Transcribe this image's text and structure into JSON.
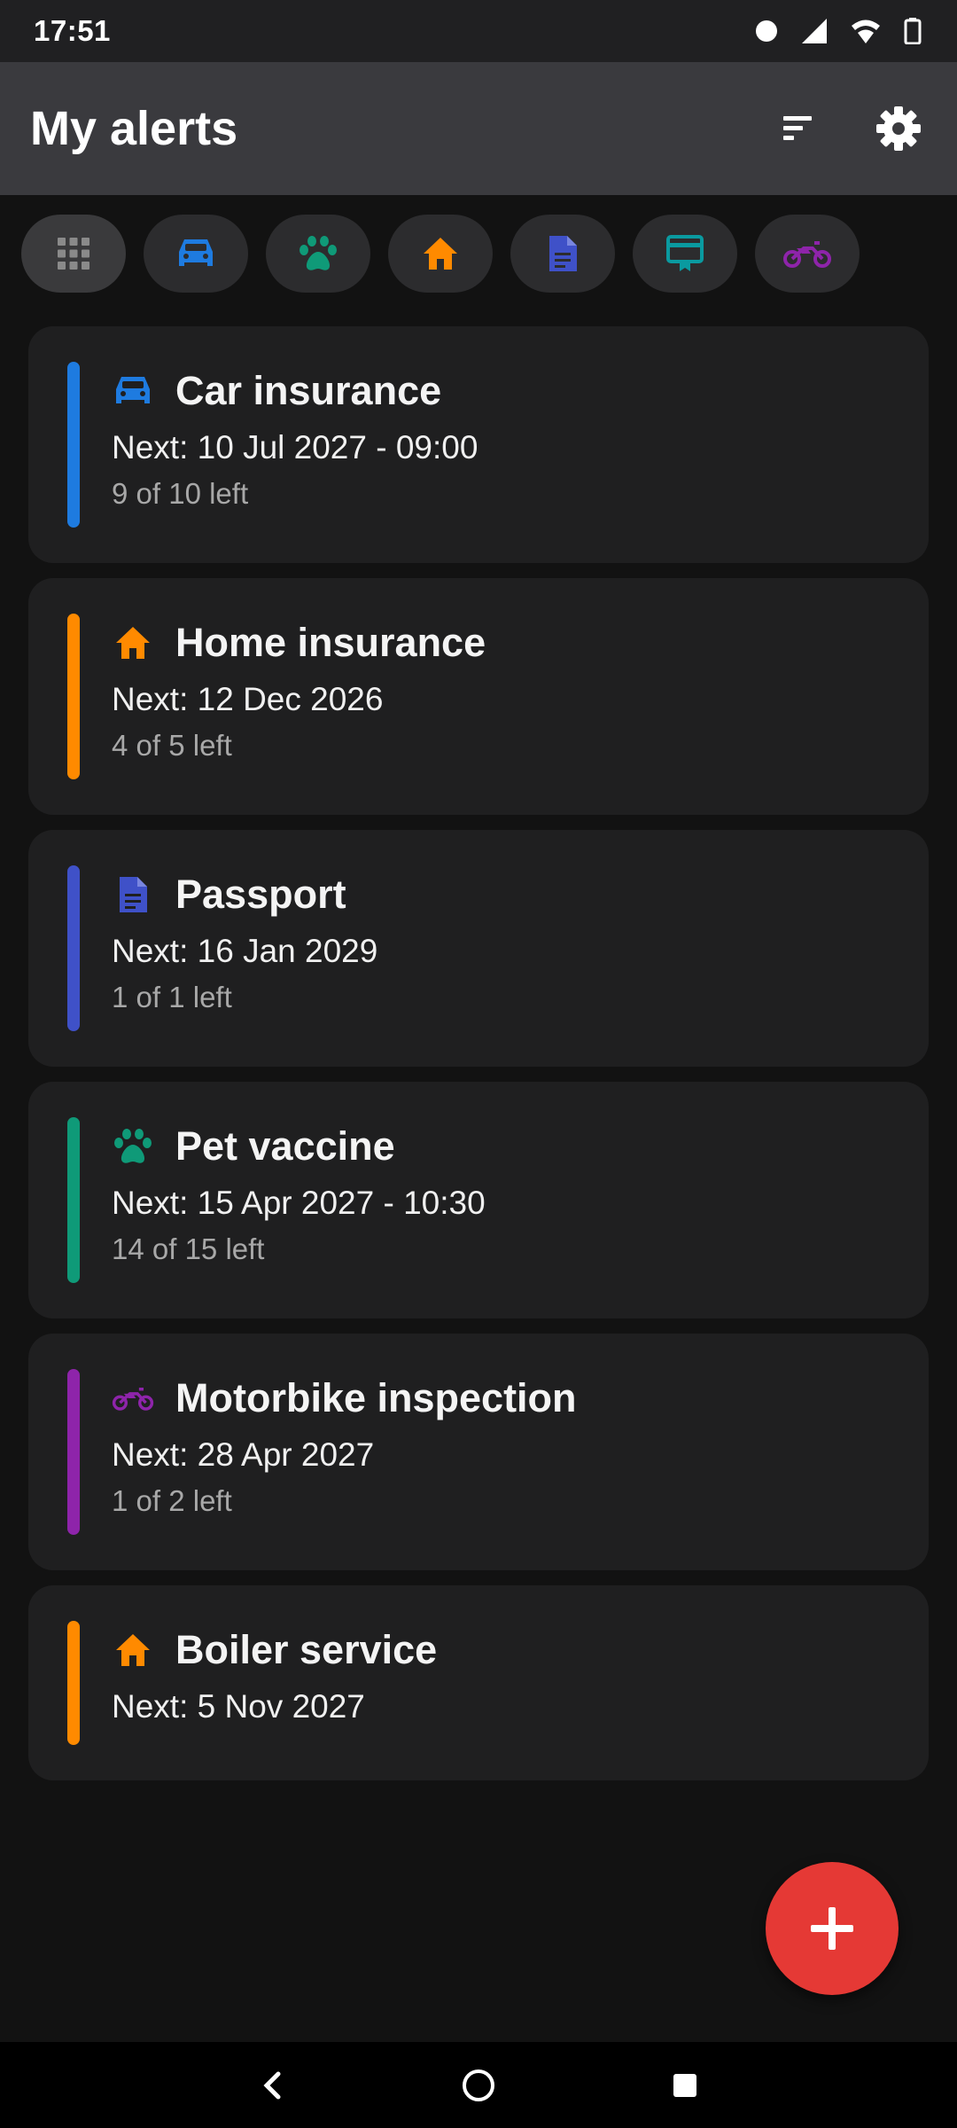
{
  "status_bar": {
    "time": "17:51",
    "icons": [
      "notification-dot-icon",
      "signal-icon",
      "wifi-icon",
      "battery-icon"
    ]
  },
  "app_bar": {
    "title": "My alerts",
    "actions": [
      "sort-icon",
      "settings-gear-icon"
    ]
  },
  "filters": [
    {
      "name": "all",
      "icon": "grid-icon",
      "color": "#8a8a8a",
      "selected": true
    },
    {
      "name": "car",
      "icon": "car-icon",
      "color": "#1e7be0",
      "selected": false
    },
    {
      "name": "pet",
      "icon": "paw-icon",
      "color": "#0f9a78",
      "selected": false
    },
    {
      "name": "home",
      "icon": "home-icon",
      "color": "#ff8a00",
      "selected": false
    },
    {
      "name": "document",
      "icon": "document-icon",
      "color": "#3f51c8",
      "selected": false
    },
    {
      "name": "card",
      "icon": "card-icon",
      "color": "#0a9aa0",
      "selected": false
    },
    {
      "name": "motorbike",
      "icon": "motorbike-icon",
      "color": "#8e24aa",
      "selected": false
    }
  ],
  "alerts": [
    {
      "title": "Car insurance",
      "next": "Next: 10 Jul 2027 - 09:00",
      "left": "9 of 10 left",
      "icon": "car-icon",
      "color": "#1e7be0"
    },
    {
      "title": "Home insurance",
      "next": "Next: 12 Dec 2026",
      "left": "4 of 5 left",
      "icon": "home-icon",
      "color": "#ff8a00"
    },
    {
      "title": "Passport",
      "next": "Next: 16 Jan 2029",
      "left": "1 of 1 left",
      "icon": "document-icon",
      "color": "#3f51c8"
    },
    {
      "title": "Pet vaccine",
      "next": "Next: 15 Apr 2027 - 10:30",
      "left": "14 of 15 left",
      "icon": "paw-icon",
      "color": "#0f9a78"
    },
    {
      "title": "Motorbike inspection",
      "next": "Next: 28 Apr 2027",
      "left": "1 of 2 left",
      "icon": "motorbike-icon",
      "color": "#8e24aa"
    },
    {
      "title": "Boiler service",
      "next": "Next: 5 Nov 2027",
      "left": "",
      "icon": "home-icon",
      "color": "#ff8a00"
    }
  ],
  "fab": {
    "icon": "plus-icon",
    "color": "#e53935"
  },
  "nav_bar": [
    "back-icon",
    "home-circle-icon",
    "recents-square-icon"
  ]
}
